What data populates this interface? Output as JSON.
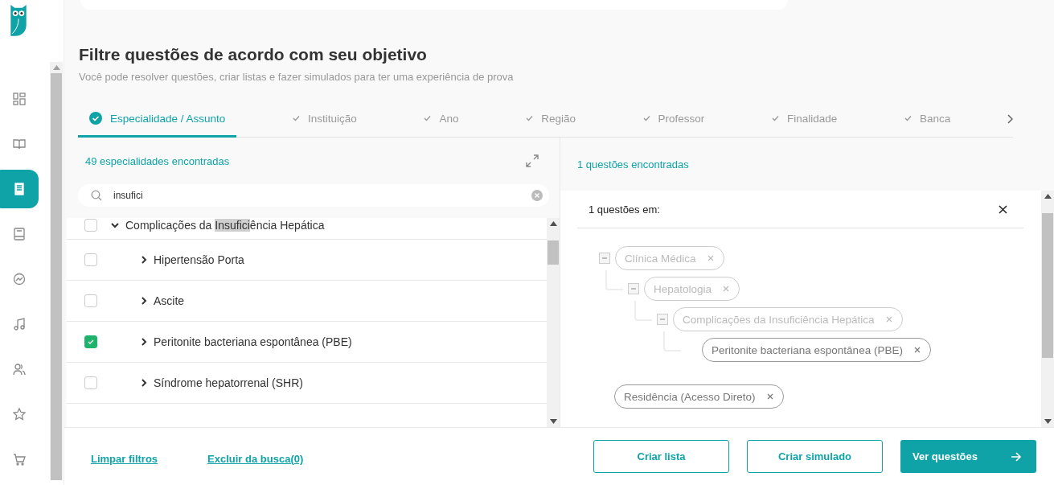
{
  "sidebar": {
    "items": [
      {
        "kind": "grid",
        "selected": false
      },
      {
        "kind": "book",
        "selected": false
      },
      {
        "kind": "document",
        "selected": true
      },
      {
        "kind": "notebook",
        "selected": false
      },
      {
        "kind": "chart",
        "selected": false
      },
      {
        "kind": "music",
        "selected": false
      },
      {
        "kind": "users",
        "selected": false
      },
      {
        "kind": "star",
        "selected": false
      },
      {
        "kind": "cart",
        "selected": false
      }
    ]
  },
  "header": {
    "title": "Filtre questões de acordo com seu objetivo",
    "subtitle": "Você pode resolver questões, criar listas e fazer simulados para ter uma experiência de prova"
  },
  "tabs": [
    {
      "label": "Especialidade / Assunto",
      "selected": true
    },
    {
      "label": "Instituição",
      "selected": false
    },
    {
      "label": "Ano",
      "selected": false
    },
    {
      "label": "Região",
      "selected": false
    },
    {
      "label": "Professor",
      "selected": false
    },
    {
      "label": "Finalidade",
      "selected": false
    },
    {
      "label": "Banca",
      "selected": false
    }
  ],
  "specialties": {
    "count_text": "49 especialidades encontradas",
    "search": {
      "value": "insufici"
    },
    "items": [
      {
        "label_parts": [
          {
            "text": "Complicações da ",
            "highlighted": false
          },
          {
            "text": "Insufici",
            "highlighted": true
          },
          {
            "text": "ência Hepática",
            "highlighted": false
          }
        ],
        "checked": false,
        "expanded": true,
        "children": [
          {
            "label_parts": [
              {
                "text": "Hipertensão Porta",
                "highlighted": false
              }
            ],
            "checked": false,
            "expanded": false
          },
          {
            "label_parts": [
              {
                "text": "Ascite",
                "highlighted": false
              }
            ],
            "checked": false,
            "expanded": false
          },
          {
            "label_parts": [
              {
                "text": "Peritonite bacteriana espontânea (PBE)",
                "highlighted": false
              }
            ],
            "checked": true,
            "expanded": false
          },
          {
            "label_parts": [
              {
                "text": "Síndrome hepatorrenal (SHR)",
                "highlighted": false
              }
            ],
            "checked": false,
            "expanded": false
          }
        ]
      }
    ]
  },
  "results": {
    "count_text": "1 questões encontradas",
    "panel_title": "1 questões em:",
    "tree": [
      {
        "label": "Clínica Médica",
        "active": false,
        "children": [
          {
            "label": "Hepatologia",
            "active": false,
            "children": [
              {
                "label": "Complicações da Insuficiência Hepática",
                "active": false,
                "children": [
                  {
                    "label": "Peritonite bacteriana espontânea (PBE)",
                    "active": true
                  }
                ]
              }
            ]
          }
        ]
      }
    ],
    "tags": [
      {
        "label": "Residência (Acesso Direto)"
      }
    ]
  },
  "footer": {
    "links": [
      "Limpar filtros",
      "Excluir da busca(0)"
    ],
    "buttons": [
      {
        "label": "Criar lista",
        "kind": "outline"
      },
      {
        "label": "Criar simulado",
        "kind": "outline"
      },
      {
        "label": "Ver questões",
        "kind": "primary"
      }
    ]
  }
}
